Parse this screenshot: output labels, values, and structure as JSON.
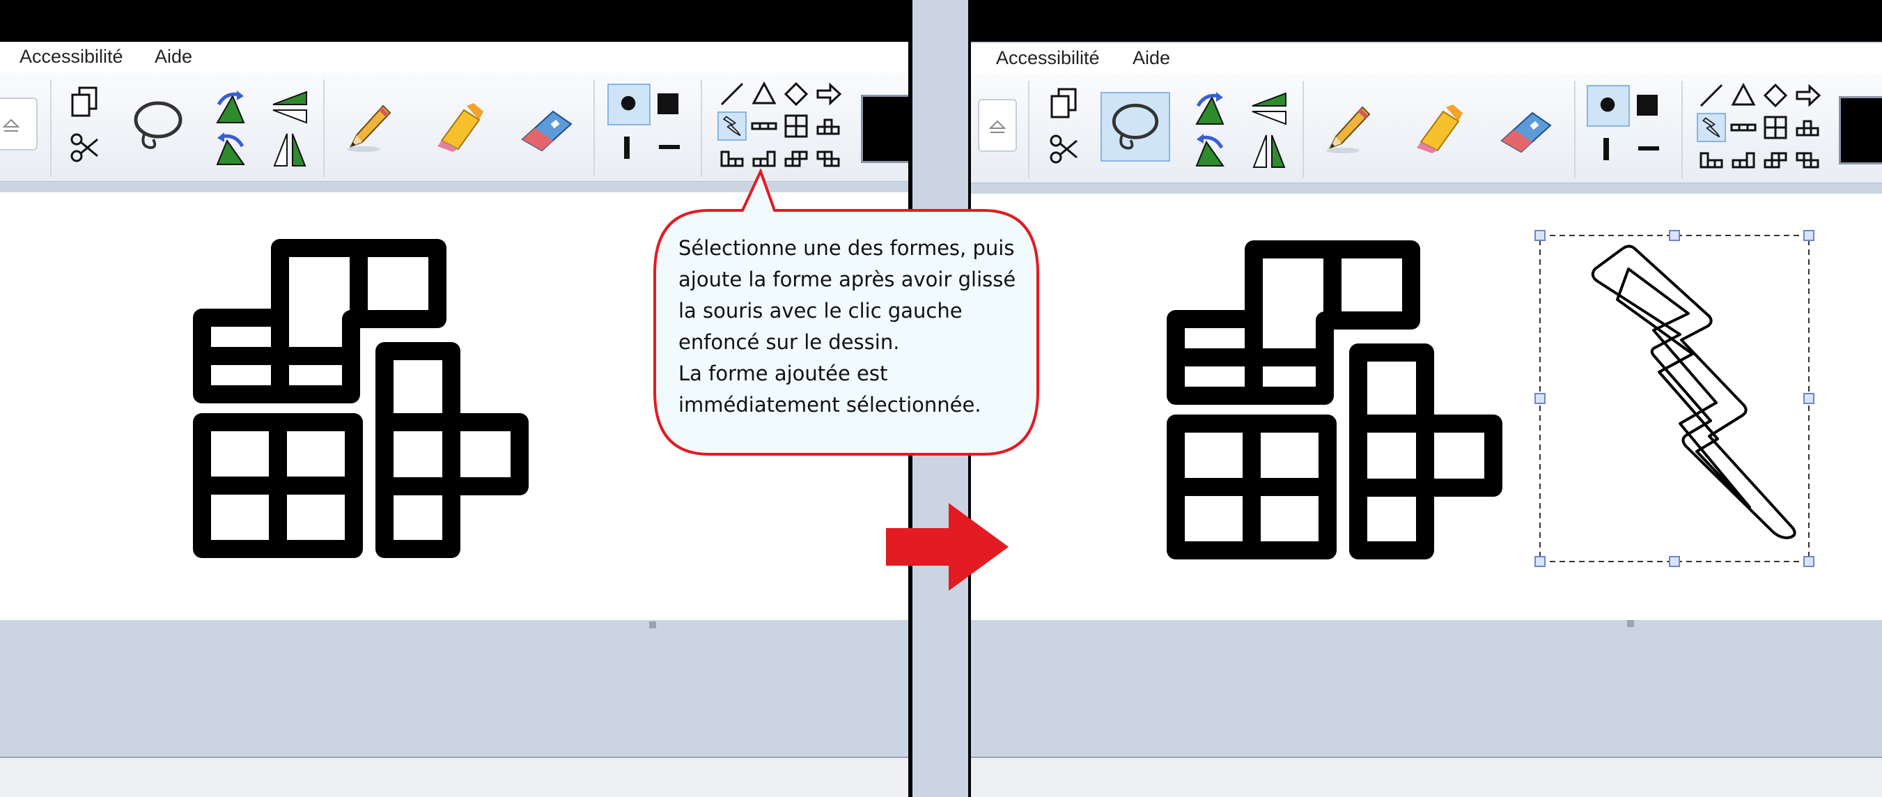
{
  "menu": {
    "left": [
      "Accessibilité",
      "Aide"
    ],
    "right": [
      "Accessibilité",
      "Aide"
    ]
  },
  "callout": {
    "lines": [
      "Sélectionne une des formes, puis",
      "ajoute la forme après avoir glissé",
      "la souris avec le clic gauche",
      "enfoncé sur le dessin.",
      "La forme ajoutée est",
      "immédiatement sélectionnée."
    ]
  },
  "icons": {
    "copy": "copy-icon",
    "cut": "scissors-icon",
    "lasso": "lasso-select-icon",
    "rotate": "rotate-icons",
    "flip": "flip-icons",
    "pencil": "pencil-icon",
    "highlighter": "highlighter-icon",
    "eraser": "eraser-icon",
    "shapes": [
      "line",
      "triangle",
      "diamond",
      "arrow",
      "lightning",
      "segment",
      "grid-square",
      "tetromino-t",
      "tetromino-l",
      "tetromino-s",
      "tetromino-z",
      "tetromino-j"
    ]
  },
  "colors": {
    "accent_red": "#e31b23",
    "callout_fill": "#f1fbfd",
    "selection_bg": "#cfe4f7",
    "selection_border": "#87b6e3",
    "handle_border": "#6b86cf",
    "workspace": "#cbd4e3"
  },
  "state": {
    "left_selected_tool": "lightning shape",
    "right_selected_tool": "lasso select + lightning shape",
    "right_shape_added": "lightning"
  }
}
